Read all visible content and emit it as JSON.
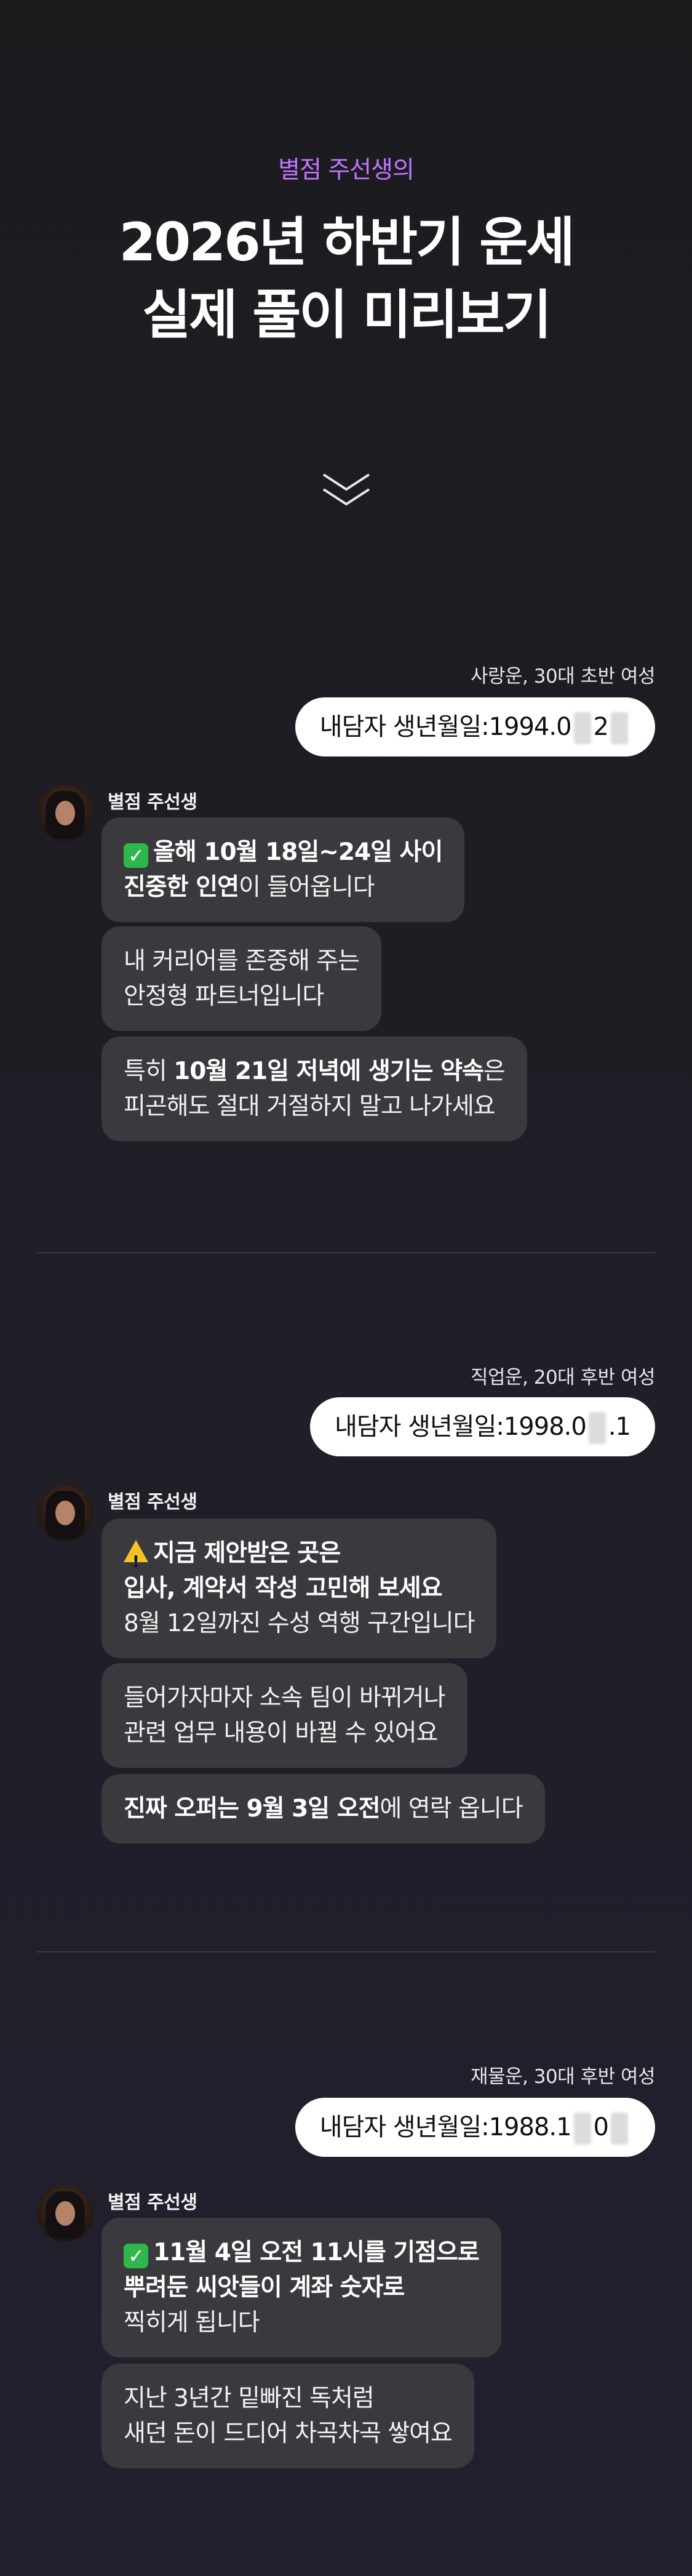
{
  "hero": {
    "kicker": "별점 주선생의",
    "title_line1": "2026년 하반기 운세",
    "title_line2": "실제 풀이 미리보기"
  },
  "icons": {
    "scroll_down": "chevron-double-down-icon"
  },
  "colors": {
    "accent": "#c173ff",
    "bubble_bot": "#3a3a3e",
    "check": "#2eb84b",
    "warn": "#f6c026"
  },
  "sections": [
    {
      "meta": "사랑운, 30대 초반 여성",
      "user_msg_prefix": "내담자 생년월일:1994.0",
      "user_msg_mid": "2",
      "user_msg_suffix": "",
      "sender": "별점 주선생",
      "msg1": {
        "strong1": "올해 10월 18일~24일 사이",
        "strong2": "진중한 인연",
        "rest2": "이 들어옵니다"
      },
      "msg2": {
        "line1": "내 커리어를 존중해 주는",
        "line2": "안정형 파트너입니다"
      },
      "msg3": {
        "pre": "특히 ",
        "strong": "10월 21일 저녁에 생기는 약속",
        "post": "은",
        "line2": "피곤해도 절대 거절하지 말고 나가세요"
      }
    },
    {
      "meta": "직업운, 20대 후반 여성",
      "user_msg_prefix": "내담자 생년월일:1998.0",
      "user_msg_mid": ".1",
      "user_msg_suffix": "",
      "sender": "별점 주선생",
      "msg1": {
        "strong1": "지금 제안받은 곳은",
        "strong2": "입사, 계약서 작성 고민해 보세요",
        "line3": "8월 12일까진 수성 역행 구간입니다"
      },
      "msg2": {
        "line1": "들어가자마자 소속 팀이 바뀌거나",
        "line2": "관련 업무 내용이 바뀔 수 있어요"
      },
      "msg3": {
        "strong": "진짜 오퍼는 9월 3일 오전",
        "post": "에 연락 옵니다"
      }
    },
    {
      "meta": "재물운, 30대 후반 여성",
      "user_msg_prefix": "내담자 생년월일:1988.1",
      "user_msg_mid": "0",
      "user_msg_suffix": "",
      "sender": "별점 주선생",
      "msg1": {
        "strong1": "11월 4일 오전 11시를 기점으로",
        "strong2": "뿌려둔 씨앗들이 계좌 숫자로",
        "line3": "찍히게 됩니다"
      },
      "msg2": {
        "line1": "지난 3년간 밑빠진 독처럼",
        "line2": "새던 돈이 드디어 차곡차곡 쌓여요"
      }
    }
  ]
}
